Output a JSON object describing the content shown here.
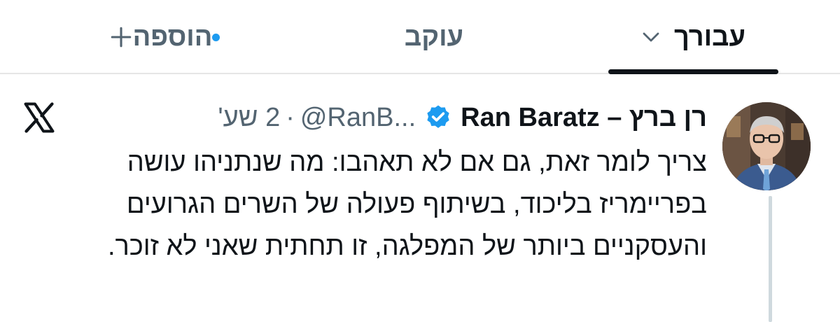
{
  "tabs": [
    {
      "label": "עבורך",
      "selected": true,
      "icon": "chevron-down-icon"
    },
    {
      "label": "עוקב",
      "selected": false
    },
    {
      "label": "הוספה",
      "selected": false,
      "icon": "plus-icon",
      "has_new_indicator": true
    }
  ],
  "colors": {
    "text_primary": "#0f1419",
    "text_secondary": "#536471",
    "accent": "#1d9bf0",
    "divider": "#e6e6e6"
  },
  "tweet": {
    "display_name": "רן ברץ – Ran Baratz",
    "verified": true,
    "handle": "@RanB...",
    "separator": "·",
    "time": "2 שע'",
    "text": "צריך לומר זאת, גם אם לא תאהבו: מה שנתניהו עושה בפריימריז בליכוד, בשיתוף פעולה של השרים הגרועים והעסקניים ביותר של המפלגה, זו תחתית שאני לא זוכר.",
    "platform_icon": "x-logo-icon",
    "avatar_icon": "avatar"
  }
}
